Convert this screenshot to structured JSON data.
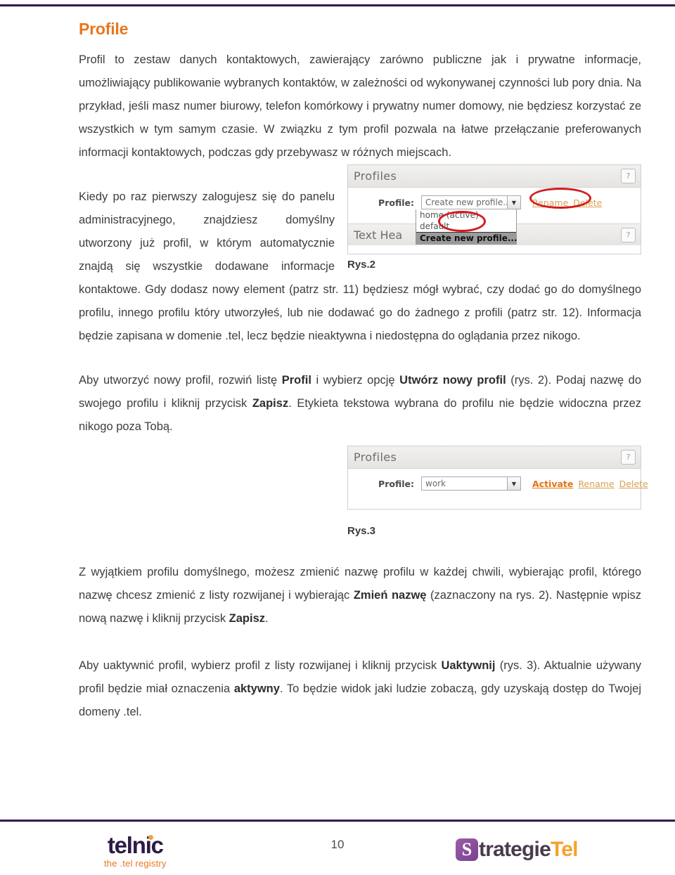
{
  "document": {
    "title": "Profile",
    "page_number": "10"
  },
  "paragraphs": {
    "p1": "Profil to zestaw danych kontaktowych, zawierający zarówno publiczne jak i prywatne informacje, umożliwiający publikowanie wybranych kontaktów, w zależności od wykonywanej czynności lub pory dnia. Na przykład, jeśli masz numer biurowy, telefon komórkowy i prywatny numer domowy, nie będziesz korzystać ze wszystkich w tym samym czasie. W związku z tym profil pozwala na łatwe przełączanie preferowanych informacji kontaktowych, podczas gdy przebywasz w różnych miejscach.",
    "p2": "Kiedy po raz pierwszy zalogujesz się do panelu administracyjnego, znajdziesz domyślny utworzony już profil, w którym automatycznie znajdą się wszystkie dodawane informacje kontaktowe. Gdy dodasz nowy element (patrz str. 11) będziesz mógł wybrać, czy dodać go do domyślnego profilu, innego profilu który utworzyłeś, lub nie dodawać go do żadnego z profili (patrz str. 12). Informacja będzie zapisana w domenie .tel, lecz będzie nieaktywna i niedostępna do oglądania przez nikogo.",
    "p3_a": "Aby utworzyć nowy profil, rozwiń listę ",
    "p3_b1": "Profil",
    "p3_c": " i wybierz opcję ",
    "p3_b2": "Utwórz nowy profil",
    "p3_d": " (rys. 2). Podaj nazwę do swojego profilu i kliknij przycisk ",
    "p3_b3": "Zapisz",
    "p3_e": ". Etykieta tekstowa wybrana do profilu nie będzie widoczna przez nikogo poza Tobą.",
    "p4_a": "Z wyjątkiem profilu domyślnego, możesz zmienić nazwę profilu w każdej chwili, wybierając profil, którego nazwę chcesz zmienić z listy rozwijanej i wybierając ",
    "p4_b1": "Zmień nazwę",
    "p4_c": " (zaznaczony na rys. 2). Następnie wpisz nową nazwę i kliknij przycisk ",
    "p4_b2": "Zapisz",
    "p4_d": ".",
    "p5_a": "Aby uaktywnić profil, wybierz profil z listy rozwijanej i kliknij przycisk ",
    "p5_b1": "Uaktywnij",
    "p5_c": " (rys. 3). Aktualnie używany profil będzie miał oznaczenia ",
    "p5_b2": "aktywny",
    "p5_d": ". To będzie widok jaki ludzie zobaczą, gdy uzyskają dostęp do Twojej domeny .tel."
  },
  "figure2": {
    "caption": "Rys.2",
    "panel_title": "Profiles",
    "help_label": "?",
    "field_label": "Profile:",
    "select_value": "Create new profile..",
    "dropdown_options": [
      "home (active)",
      "default",
      "Create new profile..."
    ],
    "link_rename": "Rename",
    "link_delete": "Delete",
    "second_panel_title": "Text Hea",
    "annotation_color": "#d31b1b"
  },
  "figure3": {
    "caption": "Rys.3",
    "panel_title": "Profiles",
    "help_label": "?",
    "field_label": "Profile:",
    "select_value": "work",
    "link_activate": "Activate",
    "link_rename": "Rename",
    "link_delete": "Delete"
  },
  "footer": {
    "telnic_word": "telnic",
    "telnic_tagline": "the .tel registry",
    "strategie_badge": "S",
    "strategie_word1": "trategie",
    "strategie_word2": "Tel"
  },
  "colors": {
    "accent_orange": "#e8761e",
    "brand_purple": "#2d1b46",
    "annotation_red": "#d31b1b",
    "link_tan": "#d8a055"
  }
}
